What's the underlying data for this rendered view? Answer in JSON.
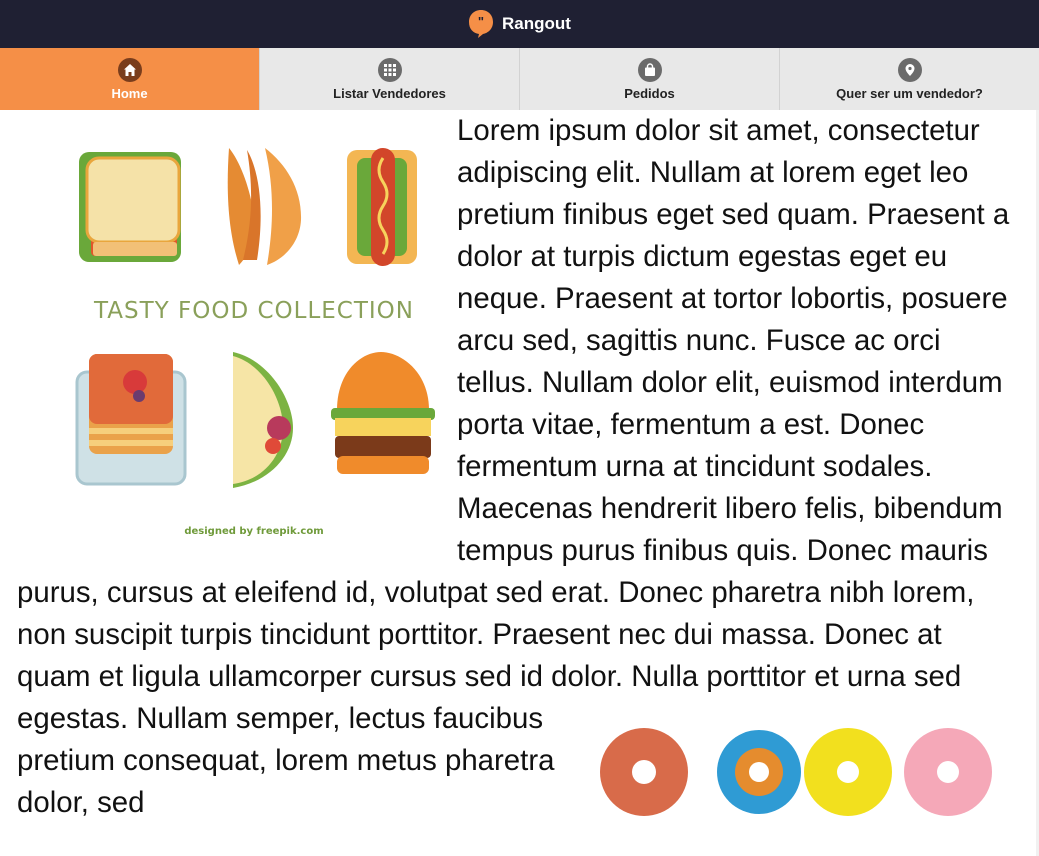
{
  "app": {
    "title": "Rangout",
    "brand_color": "#1f2033",
    "accent_color": "#f58f47"
  },
  "nav": {
    "items": [
      {
        "label": "Home",
        "icon": "home-icon",
        "active": true
      },
      {
        "label": "Listar Vendedores",
        "icon": "grid-icon",
        "active": false
      },
      {
        "label": "Pedidos",
        "icon": "shopping-bag-icon",
        "active": false
      },
      {
        "label": "Quer ser um vendedor?",
        "icon": "map-pin-icon",
        "active": false
      }
    ]
  },
  "hero_image": {
    "caption": "TASTY FOOD COLLECTION",
    "credit": "designed by freepik.com"
  },
  "article": {
    "text": "Lorem ipsum dolor sit amet, consectetur adipiscing elit. Nullam at lorem eget leo pretium finibus eget sed quam. Praesent a dolor at turpis dictum egestas eget eu neque. Praesent at tortor lobortis, posuere arcu sed, sagittis nunc. Fusce ac orci tellus. Nullam dolor elit, euismod interdum porta vitae, fermentum a est. Donec fermentum urna at tincidunt sodales. Maecenas hendrerit libero felis, bibendum tempus purus finibus quis. Donec mauris purus, cursus at eleifend id, volutpat sed erat. Donec pharetra nibh lorem, non suscipit turpis tincidunt porttitor. Praesent nec dui massa. Donec at quam et ligula ullamcorper cursus sed id dolor. Nulla porttitor et urna sed egestas. Nullam semper, lectus faucibus pretium consequat, lorem metus pharetra dolor, sed"
  }
}
